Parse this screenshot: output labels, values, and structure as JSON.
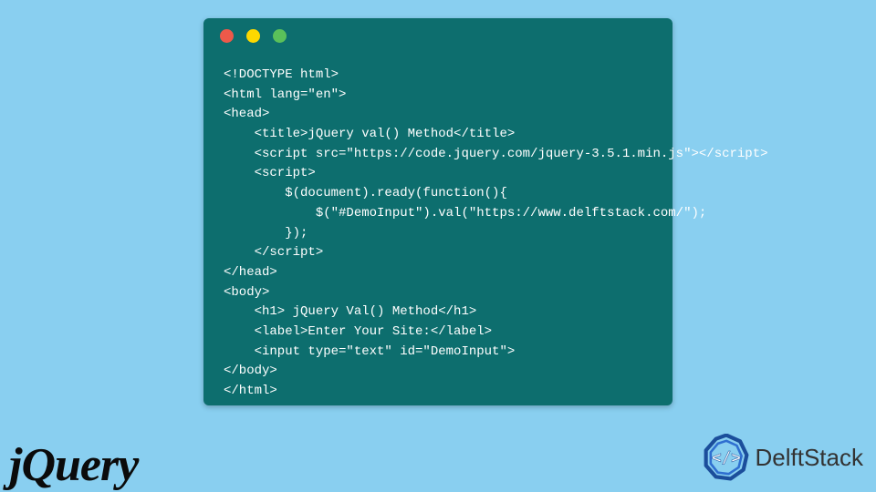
{
  "window": {
    "dots": {
      "red": "red",
      "yellow": "yellow",
      "green": "green"
    }
  },
  "code": {
    "l1": "<!DOCTYPE html>",
    "l2": "<html lang=\"en\">",
    "l3": "<head>",
    "l4": "    <title>jQuery val() Method</title>",
    "l5": "    <script src=\"https://code.jquery.com/jquery-3.5.1.min.js\"></script>",
    "l6": "    <script>",
    "l7": "        $(document).ready(function(){",
    "l8": "            $(\"#DemoInput\").val(\"https://www.delftstack.com/\");",
    "l9": "        });",
    "l10": "    </script>",
    "l11": "</head>",
    "l12": "<body>",
    "l13": "    <h1> jQuery Val() Method</h1>",
    "l14": "    <label>Enter Your Site:</label>",
    "l15": "    <input type=\"text\" id=\"DemoInput\">",
    "l16": "</body>",
    "l17": "</html>"
  },
  "logos": {
    "jquery": "jQuery",
    "delftstack": "DelftStack"
  }
}
